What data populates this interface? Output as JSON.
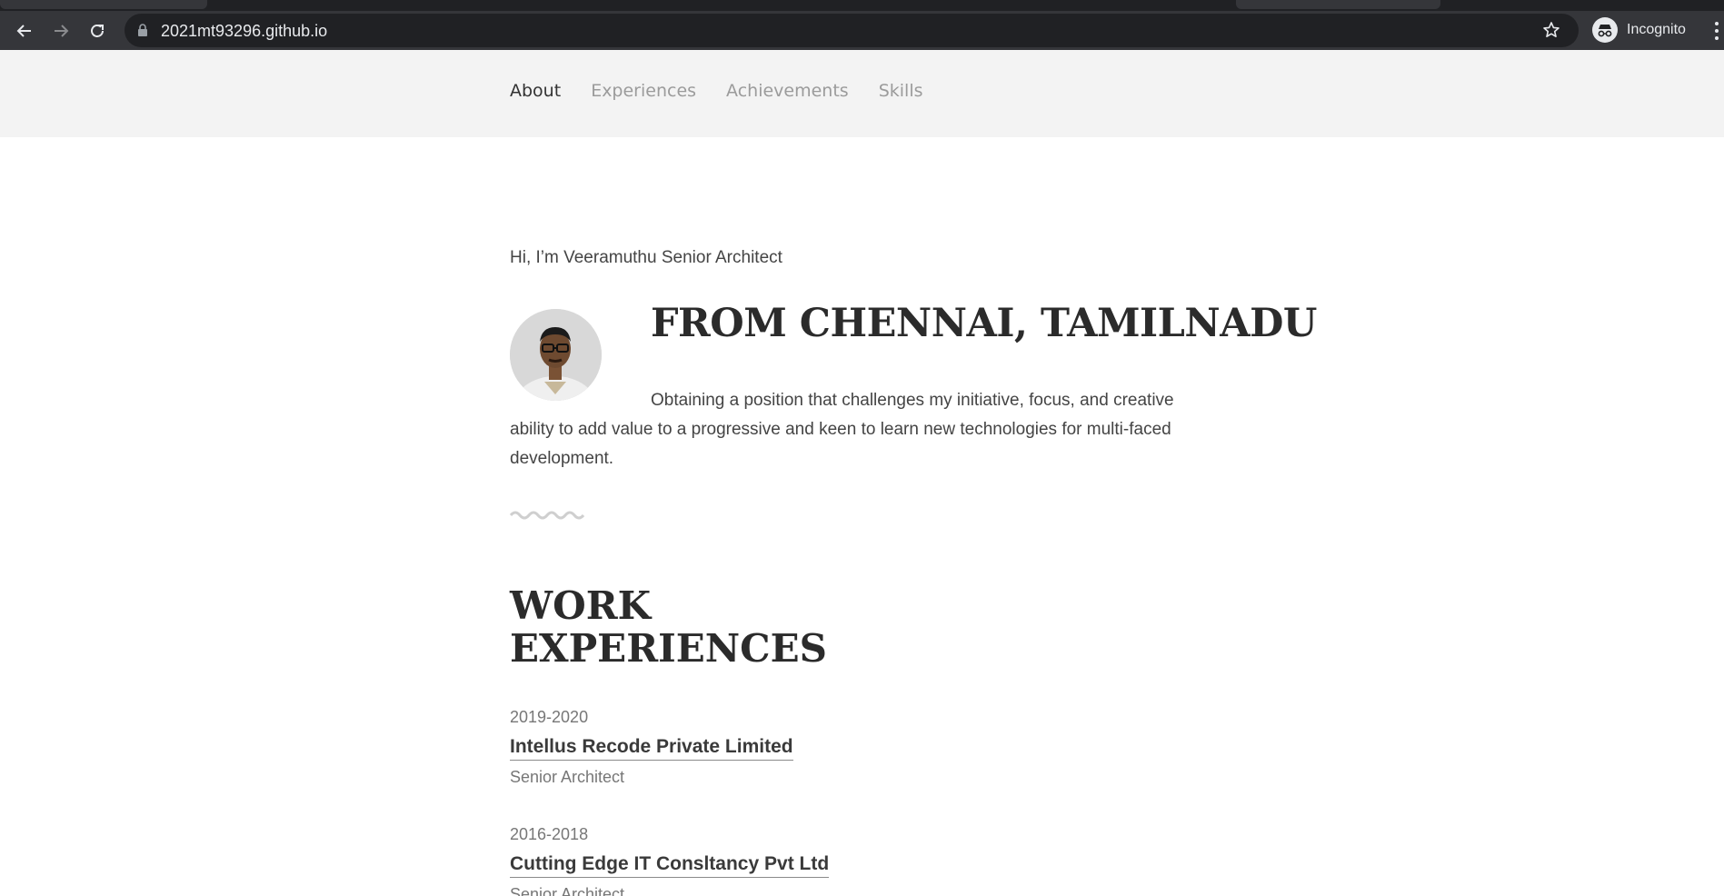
{
  "browser": {
    "url": "2021mt93296.github.io",
    "profile_label": "Incognito"
  },
  "nav": {
    "items": [
      {
        "label": "About",
        "active": true
      },
      {
        "label": "Experiences",
        "active": false
      },
      {
        "label": "Achievements",
        "active": false
      },
      {
        "label": "Skills",
        "active": false
      }
    ]
  },
  "hero": {
    "intro": "Hi, I’m Veeramuthu Senior Architect",
    "headline": "FROM CHENNAI, TAMILNADU",
    "bio": "Obtaining a position that challenges my initiative, focus, and creative ability to add value to a progressive and keen to learn new technologies for multi-faced development."
  },
  "experience": {
    "title_line1": "WORK",
    "title_line2": "EXPERIENCES",
    "jobs": [
      {
        "years": "2019-2020",
        "company": "Intellus Recode Private Limited",
        "role": "Senior Architect"
      },
      {
        "years": "2016-2018",
        "company": "Cutting Edge IT Consltancy Pvt Ltd",
        "role": "Senior Architect"
      }
    ]
  },
  "colors": {
    "chrome_dark": "#202124",
    "chrome_toolbar": "#35363a",
    "nav_bg": "#f3f3f3",
    "text_dark": "#2b2b2b",
    "text_muted": "#9b9b9b"
  }
}
